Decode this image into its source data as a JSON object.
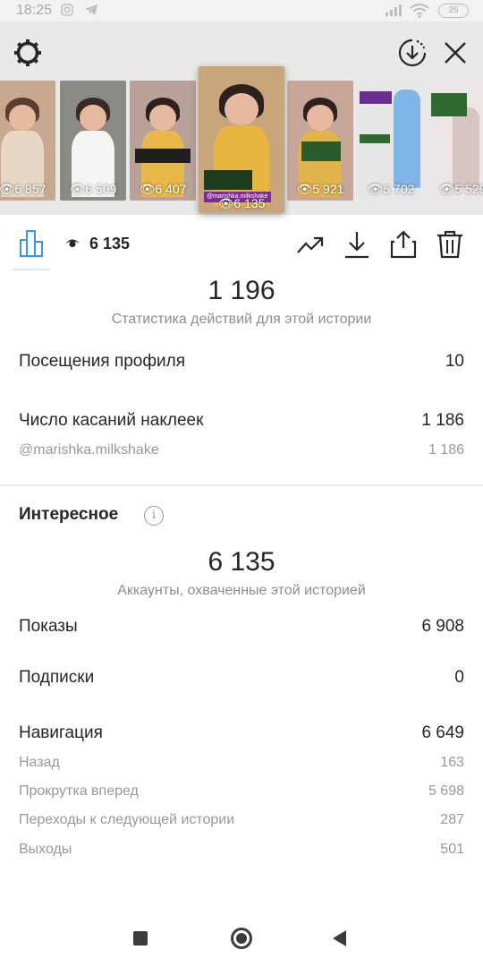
{
  "status_bar": {
    "time": "18:25",
    "battery": "26"
  },
  "stories": [
    {
      "views": "6 857",
      "bg": "#c8a98f",
      "accent": "#e7d8c6"
    },
    {
      "views": "6 509",
      "bg": "#8a8a86",
      "accent": "#ffffff"
    },
    {
      "views": "6 407",
      "bg": "#b9a199",
      "accent": "#e8b84a"
    },
    {
      "views": "6 135",
      "bg": "#c9a57c",
      "accent": "#e6b640"
    },
    {
      "views": "5 921",
      "bg": "#c7a597",
      "accent": "#e2b44c"
    },
    {
      "views": "5 702",
      "bg": "#e7e7e7",
      "accent": "#7fb6e6"
    },
    {
      "views": "5 529",
      "bg": "#ede6e6",
      "accent": "#d9c4c4"
    }
  ],
  "current_story": {
    "username": "@marishka.milkshake"
  },
  "action_bar": {
    "views": "6 135"
  },
  "actions_stats": {
    "total": "1 196",
    "caption": "Статистика действий для этой истории",
    "rows": [
      {
        "label": "Посещения профиля",
        "value": "10"
      },
      {
        "label": "Число касаний наклеек",
        "value": "1 186"
      }
    ],
    "sticker_row": {
      "label": "@marishka.milkshake",
      "value": "1 186"
    }
  },
  "discovery": {
    "title": "Интересное",
    "reach": "6 135",
    "reach_caption": "Аккаунты, охваченные этой историей",
    "impressions": {
      "label": "Показы",
      "value": "6 908"
    },
    "follows": {
      "label": "Подписки",
      "value": "0"
    },
    "navigation": {
      "label": "Навигация",
      "value": "6 649"
    },
    "nav_details": [
      {
        "label": "Назад",
        "value": "163"
      },
      {
        "label": "Прокрутка вперед",
        "value": "5 698"
      },
      {
        "label": "Переходы к следующей истории",
        "value": "287"
      },
      {
        "label": "Выходы",
        "value": "501"
      }
    ]
  }
}
